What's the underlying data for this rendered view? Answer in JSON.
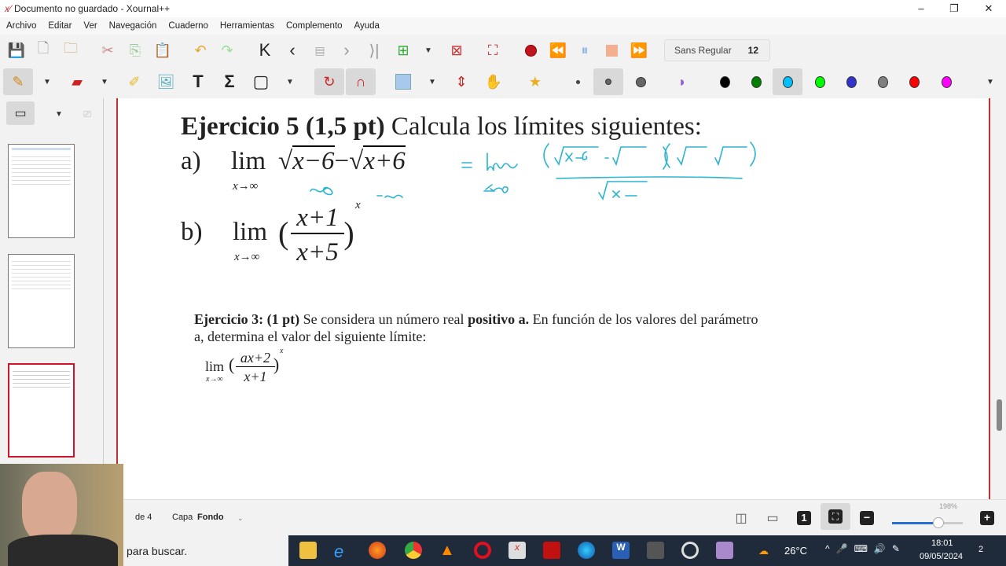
{
  "window": {
    "title": "Documento no guardado - Xournal++",
    "app_icon": "xournal-icon"
  },
  "menu": [
    "Archivo",
    "Editar",
    "Ver",
    "Navegación",
    "Cuaderno",
    "Herramientas",
    "Complemento",
    "Ayuda"
  ],
  "toolbar": {
    "font_name": "Sans Regular",
    "font_size": "12"
  },
  "colors": {
    "palette": [
      "#000000",
      "#008000",
      "#00c0ff",
      "#00ff00",
      "#3333cc",
      "#808080",
      "#ff0000",
      "#ff00ff"
    ],
    "selected_color": "#00c0ff",
    "ink": "#2bb3cf",
    "record": "#c0141e"
  },
  "document": {
    "ex5": {
      "title_bold": "Ejercicio 5 (1,5 pt)",
      "title_rest": " Calcula los límites siguientes:",
      "a_label": "a)",
      "b_label": "b)",
      "lim": "lim",
      "sub": "x→∞",
      "a_expr1": "x−6",
      "a_minus": "−",
      "a_expr2": "x+6",
      "b_num": "x+1",
      "b_den": "x+5",
      "b_exp": "x"
    },
    "ex3": {
      "bold1": "Ejercicio 3: (1 pt)",
      "t1": " Se considera un número real ",
      "bold2": "positivo a.",
      "t2": " En función de los valores del parámetro",
      "line2": "a, determina el valor del siguiente límite:",
      "lim": "lim",
      "sub": "x→∞",
      "num": "ax+2",
      "den": "x+1",
      "exp": "x"
    }
  },
  "status": {
    "page_of": "de 4",
    "layer_label": "Capa",
    "layer_value": "Fondo",
    "zoom": "198%"
  },
  "taskbar": {
    "search": "para buscar.",
    "weather": "26°C",
    "time": "18:01",
    "date": "09/05/2024",
    "notif_count": "2"
  }
}
